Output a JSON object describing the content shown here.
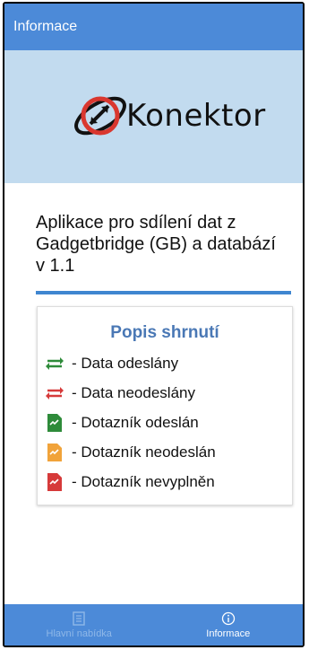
{
  "appbar": {
    "title": "Informace"
  },
  "logo": {
    "text": "Konektor"
  },
  "description": "Aplikace pro sdílení dat z Gadgetbridge (GB) a databází v 1.1",
  "summary": {
    "title": "Popis shrnutí",
    "items": [
      {
        "icon": "green-arrows-icon",
        "label": "- Data odeslány"
      },
      {
        "icon": "red-arrows-icon",
        "label": "- Data neodeslány"
      },
      {
        "icon": "green-document-icon",
        "label": "- Dotazník odeslán"
      },
      {
        "icon": "orange-document-icon",
        "label": "- Dotazník neodeslán"
      },
      {
        "icon": "red-document-icon",
        "label": "- Dotazník nevyplněn"
      }
    ]
  },
  "bottom_nav": {
    "items": [
      {
        "label": "Hlavní nabídka",
        "icon": "menu-grid-icon",
        "active": false
      },
      {
        "label": "Informace",
        "icon": "info-icon",
        "active": true
      }
    ]
  },
  "colors": {
    "primary": "#4c8ad8",
    "hero": "#c2dbef",
    "green": "#2e8b3a",
    "red": "#d63a3a",
    "orange": "#f1a33a",
    "title_blue": "#4a78b5"
  }
}
